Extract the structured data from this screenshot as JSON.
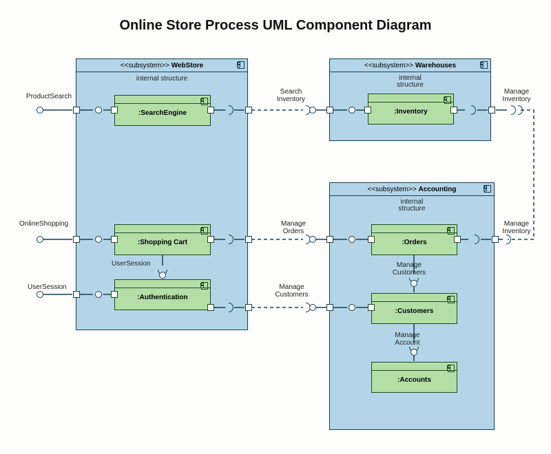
{
  "title": "Online Store Process UML Component Diagram",
  "stereotype": "<<subsystem>>",
  "internal_structure": "internal structure",
  "webstore": {
    "name": "WebStore",
    "components": {
      "search": ":SearchEngine",
      "cart": ":Shopping Cart",
      "auth": ":Authentication"
    }
  },
  "warehouses": {
    "name": "Warehouses",
    "components": {
      "inventory": ":Inventory"
    }
  },
  "accounting": {
    "name": "Accounting",
    "components": {
      "orders": ":Orders",
      "customers": ":Customers",
      "accounts": ":Accounts"
    }
  },
  "labels": {
    "product_search": "ProductSearch",
    "online_shopping": "OnlineShopping",
    "user_session_ext": "UserSession",
    "user_session_int": "UserSession",
    "search_inventory": "Search Inventory",
    "manage_orders": "Manage Orders",
    "manage_customers": "Manage Customers",
    "manage_customers_int": "Manage Customers",
    "manage_account_int": "Manage Account",
    "manage_inventory_top": "Manage Inventory",
    "manage_inventory_bottom": "Manage Inventory"
  }
}
